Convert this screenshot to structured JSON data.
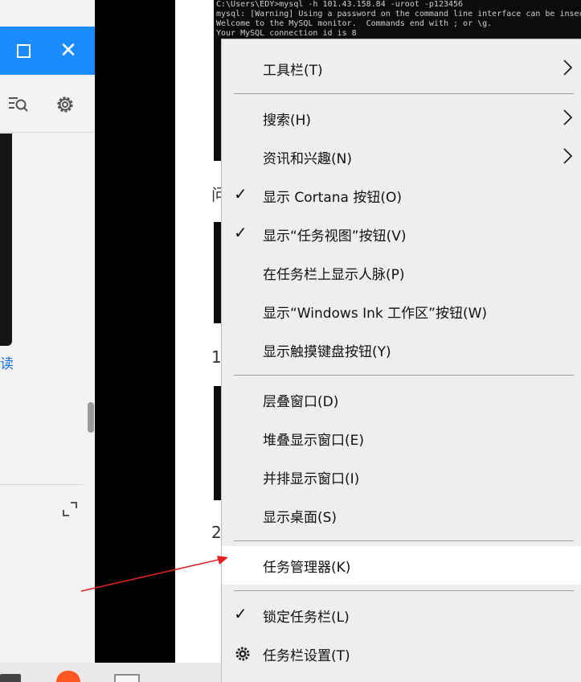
{
  "window": {
    "maximize_icon": "maximize-icon",
    "close_label": "✕"
  },
  "left": {
    "read_label": "读"
  },
  "terminal": {
    "lines": [
      "C:\\Users\\EDY>mysql -h 101.43.158.84 -uroot -p123456",
      "mysql: [Warning] Using a password on the command line interface can be insecure.",
      "Welcome to the MySQL monitor.  Commands end with ; or \\g.",
      "Your MySQL connection id is 8"
    ]
  },
  "background_chars": [
    "问",
    "1",
    "2"
  ],
  "menu": {
    "items": [
      {
        "label": "工具栏(T)",
        "submenu": true
      },
      {
        "label": "搜索(H)",
        "submenu": true
      },
      {
        "label": "资讯和兴趣(N)",
        "submenu": true
      },
      {
        "label": "显示 Cortana 按钮(O)",
        "checked": true
      },
      {
        "label": "显示“任务视图”按钮(V)",
        "checked": true
      },
      {
        "label": "在任务栏上显示人脉(P)"
      },
      {
        "label": "显示“Windows Ink 工作区”按钮(W)"
      },
      {
        "label": "显示触摸键盘按钮(Y)"
      },
      {
        "label": "层叠窗口(D)"
      },
      {
        "label": "堆叠显示窗口(E)"
      },
      {
        "label": "并排显示窗口(I)"
      },
      {
        "label": "显示桌面(S)"
      },
      {
        "label": "任务管理器(K)",
        "highlighted": true
      },
      {
        "label": "锁定任务栏(L)",
        "checked": true
      },
      {
        "label": "任务栏设置(T)",
        "icon": "gear-icon"
      }
    ],
    "check_glyph": "✓"
  },
  "colors": {
    "titlebar": "#1a8cff",
    "arrow": "#e02020",
    "menu_bg": "#eeeeee",
    "highlight": "#ffffff"
  }
}
